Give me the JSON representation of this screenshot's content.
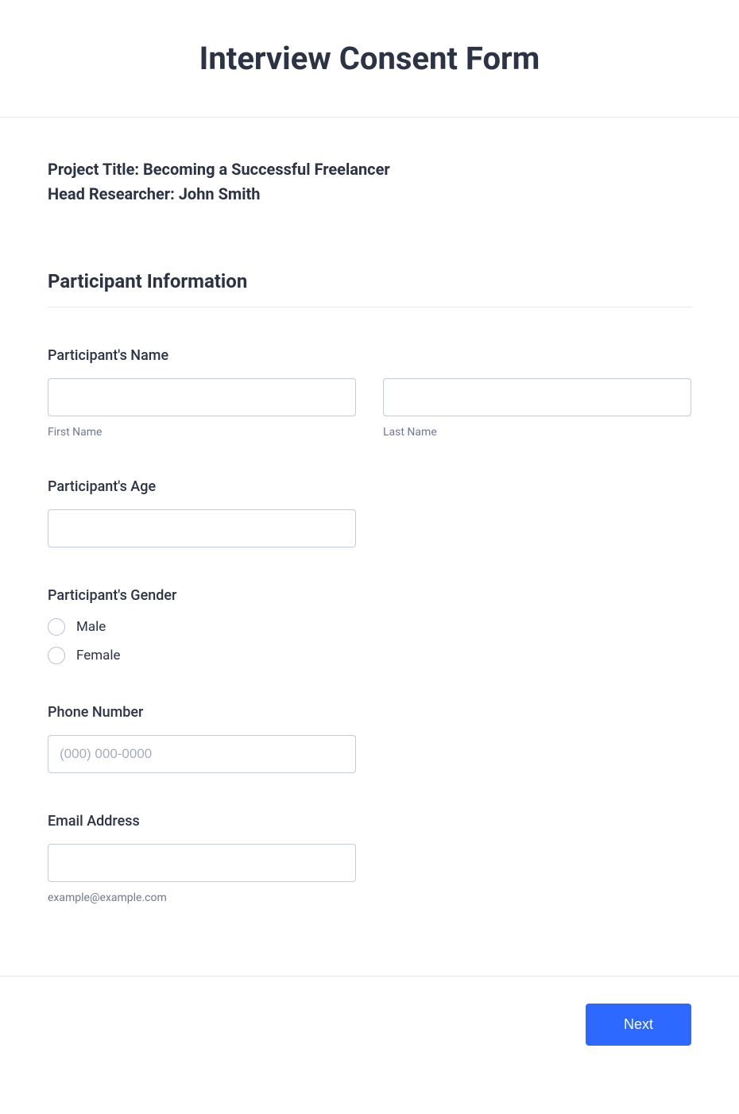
{
  "header": {
    "title": "Interview Consent Form"
  },
  "intro": {
    "project_title_line": "Project Title: Becoming a Successful Freelancer",
    "head_researcher_line": "Head Researcher: John Smith"
  },
  "section": {
    "heading": "Participant Information"
  },
  "fields": {
    "name": {
      "label": "Participant's Name",
      "first_sublabel": "First Name",
      "last_sublabel": "Last Name",
      "first_value": "",
      "last_value": ""
    },
    "age": {
      "label": "Participant's Age",
      "value": ""
    },
    "gender": {
      "label": "Participant's Gender",
      "options": {
        "male": "Male",
        "female": "Female"
      }
    },
    "phone": {
      "label": "Phone Number",
      "placeholder": "(000) 000-0000",
      "value": ""
    },
    "email": {
      "label": "Email Address",
      "value": "",
      "sublabel": "example@example.com"
    }
  },
  "footer": {
    "next_label": "Next"
  }
}
